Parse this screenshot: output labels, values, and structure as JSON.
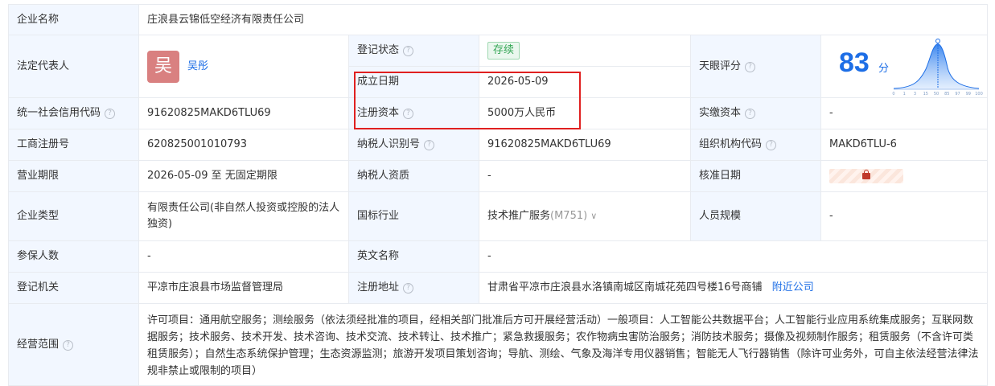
{
  "company": {
    "name_label": "企业名称",
    "name": "庄浪县云锦低空经济有限责任公司"
  },
  "legal_rep": {
    "label": "法定代表人",
    "avatar_char": "吴",
    "name": "吴彤"
  },
  "status": {
    "label": "登记状态",
    "value": "存续",
    "badge_color": "#33a654"
  },
  "established": {
    "label": "成立日期",
    "value": "2026-05-09"
  },
  "rating": {
    "label": "天眼评分",
    "score": "83",
    "unit": "分",
    "axis_ticks": [
      "0",
      "1",
      "3",
      "15",
      "50",
      "85",
      "97",
      "99",
      "100"
    ],
    "accent_color": "#1d6ee6"
  },
  "credit_code": {
    "label": "统一社会信用代码",
    "value": "91620825MAKD6TLU69"
  },
  "registered_capital": {
    "label": "注册资本",
    "value": "5000万人民币"
  },
  "paid_capital": {
    "label": "实缴资本",
    "value": "-"
  },
  "biz_reg_no": {
    "label": "工商注册号",
    "value": "620825001010793"
  },
  "taxpayer_id": {
    "label": "纳税人识别号",
    "value": "91620825MAKD6TLU69"
  },
  "org_code": {
    "label": "组织机构代码",
    "value": "MAKD6TLU-6"
  },
  "term": {
    "label": "营业期限",
    "value": "2026-05-09 至 无固定期限"
  },
  "taxpayer_qual": {
    "label": "纳税人资质",
    "value": "-"
  },
  "approval_date": {
    "label": "核准日期"
  },
  "company_type": {
    "label": "企业类型",
    "value": "有限责任公司(非自然人投资或控股的法人独资)"
  },
  "industry": {
    "label": "国标行业",
    "value": "技术推广服务",
    "code": "(M751)"
  },
  "staff_size": {
    "label": "人员规模",
    "value": "-"
  },
  "insured": {
    "label": "参保人数",
    "value": "-"
  },
  "english_name": {
    "label": "英文名称",
    "value": "-"
  },
  "authority": {
    "label": "登记机关",
    "value": "平凉市庄浪县市场监督管理局"
  },
  "address": {
    "label": "注册地址",
    "value": "甘肃省平凉市庄浪县水洛镇南城区南城花苑四号楼16号商铺",
    "nearby_link": "附近公司"
  },
  "scope": {
    "label": "经营范围",
    "value": "许可项目：通用航空服务；测绘服务（依法须经批准的项目，经相关部门批准后方可开展经营活动）一般项目：人工智能公共数据平台；人工智能行业应用系统集成服务；互联网数据服务；技术服务、技术开发、技术咨询、技术交流、技术转让、技术推广；紧急救援服务；农作物病虫害防治服务；消防技术服务；摄像及视频制作服务；租赁服务（不含许可类租赁服务）；自然生态系统保护管理；生态资源监测；旅游开发项目策划咨询；导航、测绘、气象及海洋专用仪器销售；智能无人飞行器销售（除许可业务外，可自主依法经营法律法规非禁止或限制的项目）"
  }
}
